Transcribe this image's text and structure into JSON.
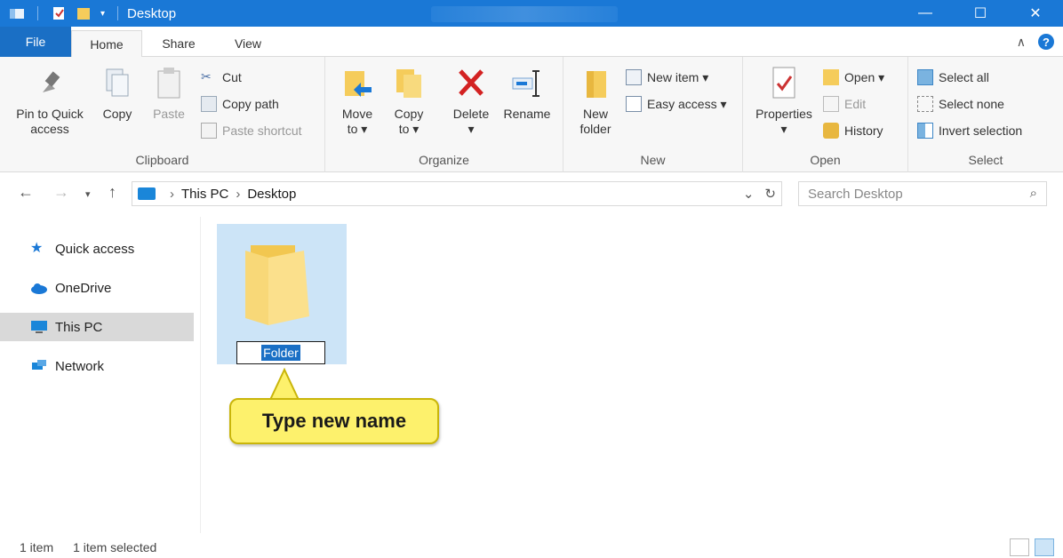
{
  "window": {
    "title": "Desktop",
    "minimize": "—",
    "maximize": "☐",
    "close": "✕"
  },
  "tabs": {
    "file": "File",
    "home": "Home",
    "share": "Share",
    "view": "View"
  },
  "ribbon": {
    "clipboard": {
      "label": "Clipboard",
      "pin": "Pin to Quick",
      "pin2": "access",
      "copy": "Copy",
      "paste": "Paste",
      "cut": "Cut",
      "copy_path": "Copy path",
      "paste_shortcut": "Paste shortcut"
    },
    "organize": {
      "label": "Organize",
      "move_to": "Move",
      "move_to2": "to ▾",
      "copy_to": "Copy",
      "copy_to2": "to ▾",
      "delete": "Delete",
      "delete2": "▾",
      "rename": "Rename"
    },
    "new": {
      "label": "New",
      "new_folder": "New",
      "new_folder2": "folder",
      "new_item": "New item ▾",
      "easy_access": "Easy access ▾"
    },
    "open": {
      "label": "Open",
      "properties": "Properties",
      "properties2": "▾",
      "open": "Open ▾",
      "edit": "Edit",
      "history": "History"
    },
    "select": {
      "label": "Select",
      "select_all": "Select all",
      "select_none": "Select none",
      "invert": "Invert selection"
    }
  },
  "address": {
    "crumb1": "This PC",
    "crumb2": "Desktop",
    "search_placeholder": "Search Desktop"
  },
  "sidebar": {
    "items": [
      {
        "label": "Quick access"
      },
      {
        "label": "OneDrive"
      },
      {
        "label": "This PC"
      },
      {
        "label": "Network"
      }
    ]
  },
  "content": {
    "rename_value": "Folder",
    "callout": "Type new name"
  },
  "status": {
    "count": "1 item",
    "selected": "1 item selected"
  },
  "colors": {
    "titlebar": "#1a78d6",
    "file_tab": "#1a6fc5",
    "selection": "#cce4f7",
    "callout": "#fdf16c"
  }
}
